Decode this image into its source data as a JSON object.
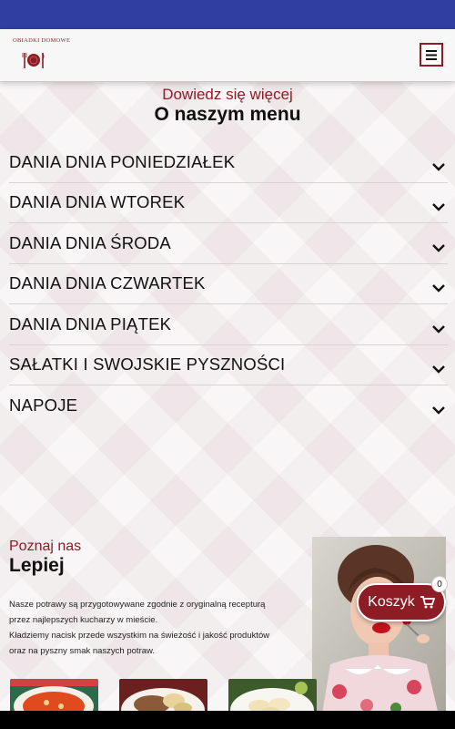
{
  "header": {
    "logo_text": "OBIADKI DOMOWE",
    "menu_icon": "hamburger-icon"
  },
  "menu_section": {
    "subtitle": "Dowiedz się więcej",
    "title": "O naszym menu",
    "items": [
      {
        "label": "DANIA DNIA PONIEDZIAŁEK"
      },
      {
        "label": "DANIA DNIA WTOREK"
      },
      {
        "label": "DANIA DNIA ŚRODA"
      },
      {
        "label": "DANIA DNIA CZWARTEK"
      },
      {
        "label": "DANIA DNIA PIĄTEK"
      },
      {
        "label": "SAŁATKI I SWOJSKIE PYSZNOŚCI"
      },
      {
        "label": "NAPOJE"
      }
    ]
  },
  "about_section": {
    "subtitle": "Poznaj nas",
    "title": "Lepiej",
    "line1": "Nasze potrawy są przygotowywane zgodnie z oryginalną recepturą",
    "line2": "przez najlepszych kucharzy w mieście.",
    "line3": "Kładziemy nacisk przede wszystkim na świeżość i jakość produktów",
    "line4": "oraz na pyszny smak naszych potraw."
  },
  "cart": {
    "label": "Koszyk",
    "count": "0",
    "icon": "cart-icon"
  },
  "colors": {
    "accent": "#8e1c25",
    "status_bar": "#2f3ea0"
  }
}
